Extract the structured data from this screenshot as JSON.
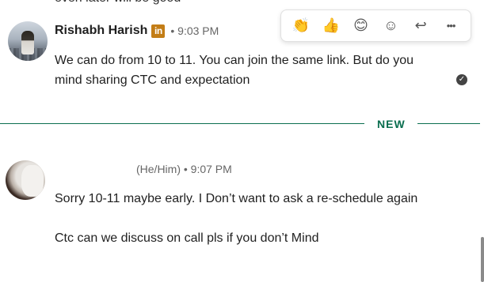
{
  "previous_message": {
    "text": "even later will be good"
  },
  "message1": {
    "sender_name": "Rishabh Harish",
    "badge_text": "in",
    "separator": "•",
    "time": "9:03 PM",
    "text": "We can do from 10 to 11. You can join the same link. But do you mind sharing CTC and expectation",
    "avatar_icon": "profile-photo",
    "status_icon": "seen-check-icon"
  },
  "reaction_bar": {
    "buttons": [
      {
        "icon": "clap-icon",
        "glyph": "👏"
      },
      {
        "icon": "thumbs-up-icon",
        "glyph": "👍"
      },
      {
        "icon": "smile-icon",
        "glyph": "😊"
      },
      {
        "icon": "add-reaction-icon",
        "glyph": "☺"
      },
      {
        "icon": "reply-icon",
        "glyph": "↩"
      },
      {
        "icon": "more-icon",
        "glyph": "•••"
      }
    ]
  },
  "divider": {
    "label": "NEW",
    "color": "#0a6e4f"
  },
  "message2": {
    "sender_meta": "(He/Him) • 9:07 PM",
    "paragraph1": "Sorry 10-11 maybe early. I Don’t want to ask a re-schedule again",
    "paragraph2": "Ctc can we discuss on call pls if you don’t Mind"
  },
  "colors": {
    "accent": "#0a6e4f",
    "badge": "#c37d16"
  }
}
